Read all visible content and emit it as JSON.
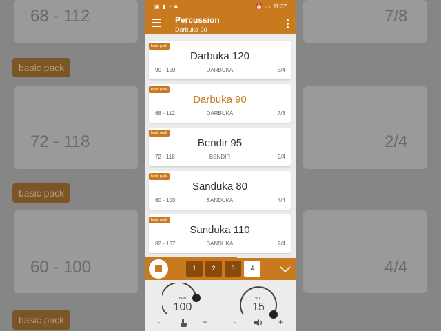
{
  "background": {
    "texts": [
      "68 - 112",
      "7/8",
      "72 - 118",
      "2/4",
      "60 - 100",
      "4/4"
    ],
    "badge": "basic pack"
  },
  "status": {
    "time": "11:37"
  },
  "appbar": {
    "title": "Percussion",
    "subtitle": "Darbuka 90"
  },
  "rhythms": [
    {
      "badge": "basic pack",
      "name": "Darbuka 120",
      "range": "90 - 150",
      "style": "DARBUKA",
      "signature": "3/4",
      "active": false
    },
    {
      "badge": "basic pack",
      "name": "Darbuka 90",
      "range": "68 - 112",
      "style": "DARBUKA",
      "signature": "7/8",
      "active": true
    },
    {
      "badge": "basic pack",
      "name": "Bendir 95",
      "range": "72 - 118",
      "style": "BENDIR",
      "signature": "2/4",
      "active": false
    },
    {
      "badge": "basic pack",
      "name": "Sanduka 80",
      "range": "60 - 100",
      "style": "SANDUKA",
      "signature": "4/4",
      "active": false
    },
    {
      "badge": "basic pack",
      "name": "Sanduka 110",
      "range": "82 - 137",
      "style": "SANDUKA",
      "signature": "2/4",
      "active": false
    }
  ],
  "playback_progress": 0.61,
  "transport": {
    "beats": [
      "1",
      "2",
      "3",
      "4"
    ],
    "selected_beat": "4"
  },
  "controls": {
    "bpm": {
      "label": "BPM",
      "value": "100",
      "minus": "-",
      "plus": "+"
    },
    "vol": {
      "label": "VOL",
      "value": "15",
      "minus": "-",
      "plus": "+"
    }
  },
  "colors": {
    "accent": "#c9791e",
    "beat_dark": "#8a4a0c",
    "active_text": "#c9791e"
  },
  "icons": [
    "menu-icon",
    "more-vert-icon",
    "stop-icon",
    "chevron-down-icon",
    "tap-hand-icon",
    "speaker-icon"
  ]
}
